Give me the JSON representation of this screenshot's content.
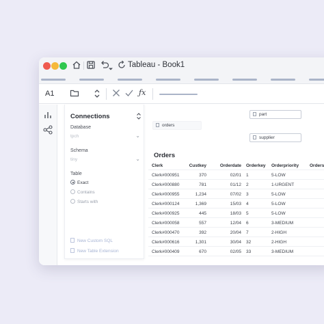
{
  "titlebar": {
    "title": "Tableau - Book1",
    "icons": [
      "home-icon",
      "save-icon",
      "undo-icon",
      "dropdown-icon",
      "refresh-icon"
    ]
  },
  "formula": {
    "cell_ref": "A1",
    "icons": [
      "folder-icon",
      "stepper-icon",
      "cancel-icon",
      "confirm-icon",
      "fx-icon"
    ]
  },
  "rail": {
    "icons": [
      "chart-icon",
      "share-icon"
    ]
  },
  "connections": {
    "title": "Connections",
    "database_label": "Database",
    "database_value": "tpch",
    "schema_label": "Schema",
    "schema_value": "tiny",
    "table_label": "Table",
    "radio_exact": "Exact",
    "radio_contains": "Contains",
    "radio_starts": "Starts with",
    "new_custom_sql": "New Custom SQL",
    "new_table_extension": "New Table Extension"
  },
  "canvas": {
    "chip_orders": "orders",
    "chip_part": "part",
    "chip_supplier": "supplier"
  },
  "orders": {
    "title": "Orders",
    "columns": [
      "Clerk",
      "Custkey",
      "Orderdate",
      "Orderkey",
      "Orderpriority",
      "Orders"
    ],
    "rows": [
      [
        "Clerk#000951",
        "370",
        "02/01",
        "1",
        "5-LOW"
      ],
      [
        "Clerk#000880",
        "781",
        "01/12",
        "2",
        "1-URGENT"
      ],
      [
        "Clerk#000955",
        "1,234",
        "07/02",
        "3",
        "5-LOW"
      ],
      [
        "Clerk#000124",
        "1,369",
        "15/03",
        "4",
        "5-LOW"
      ],
      [
        "Clerk#000925",
        "445",
        "18/03",
        "5",
        "5-LOW"
      ],
      [
        "Clerk#000058",
        "557",
        "12/04",
        "6",
        "3-MEDIUM"
      ],
      [
        "Clerk#000470",
        "392",
        "20/04",
        "7",
        "2-HIGH"
      ],
      [
        "Clerk#000616",
        "1,301",
        "30/04",
        "32",
        "2-HIGH"
      ],
      [
        "Clerk#000409",
        "670",
        "02/05",
        "33",
        "3-MEDIUM"
      ]
    ]
  },
  "colors": {
    "background": "#ecebf7",
    "accent_line": "#aab4c8",
    "traffic_red": "#ef5a4f",
    "traffic_yellow": "#f6b93b",
    "traffic_green": "#2fc74f"
  }
}
